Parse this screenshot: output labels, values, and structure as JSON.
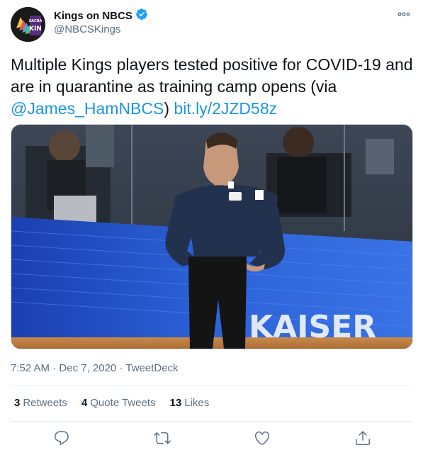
{
  "author": {
    "display_name": "Kings on NBCS",
    "handle": "@NBCSKings",
    "avatar_text": "SACRA KIN"
  },
  "tweet": {
    "text_main": "Multiple Kings players tested positive for COVID-19 and are in quarantine as training camp opens (via ",
    "mention": "@James_HamNBCS",
    "text_mid": ") ",
    "link": "bit.ly/2JZD58z",
    "image_overlay_text": "KAISER"
  },
  "meta": {
    "time": "7:52 AM",
    "separator": "·",
    "date": "Dec 7, 2020",
    "source": "TweetDeck"
  },
  "stats": {
    "retweets_count": "3",
    "retweets_label": "Retweets",
    "quotes_count": "4",
    "quotes_label": "Quote Tweets",
    "likes_count": "13",
    "likes_label": "Likes"
  },
  "icons": {
    "verified": "verified-badge-icon",
    "more": "more-icon",
    "reply": "reply-icon",
    "retweet": "retweet-icon",
    "like": "like-icon",
    "share": "share-icon"
  },
  "colors": {
    "accent": "#1da1f2",
    "link": "#1b95e0",
    "secondary_text": "#5b7083",
    "divider": "#e6ecf0"
  }
}
